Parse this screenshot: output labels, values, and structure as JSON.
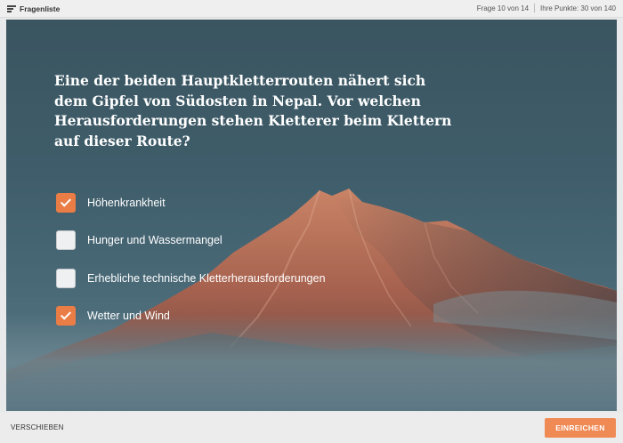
{
  "header": {
    "question_list_label": "Fragenliste",
    "question_counter": "Frage 10 von 14",
    "score": "Ihre Punkte: 30 von 140"
  },
  "question": {
    "text": "Eine der beiden Hauptkletterrouten nähert sich dem Gipfel von Südosten in Nepal. Vor welchen Herausforderungen stehen Kletterer beim Klettern auf dieser Route?"
  },
  "options": [
    {
      "label": "Höhenkrankheit",
      "checked": true
    },
    {
      "label": "Hunger und Wassermangel",
      "checked": false
    },
    {
      "label": "Erhebliche technische Kletterherausforderungen",
      "checked": false
    },
    {
      "label": "Wetter und Wind",
      "checked": true
    }
  ],
  "footer": {
    "skip_label": "VERSCHIEBEN",
    "submit_label": "EINREICHEN"
  },
  "colors": {
    "accent": "#ea7d45",
    "submit": "#ef8a55",
    "sky": "#3f5d6a"
  },
  "icons": {
    "list": "list-icon",
    "check": "checkmark-icon"
  }
}
